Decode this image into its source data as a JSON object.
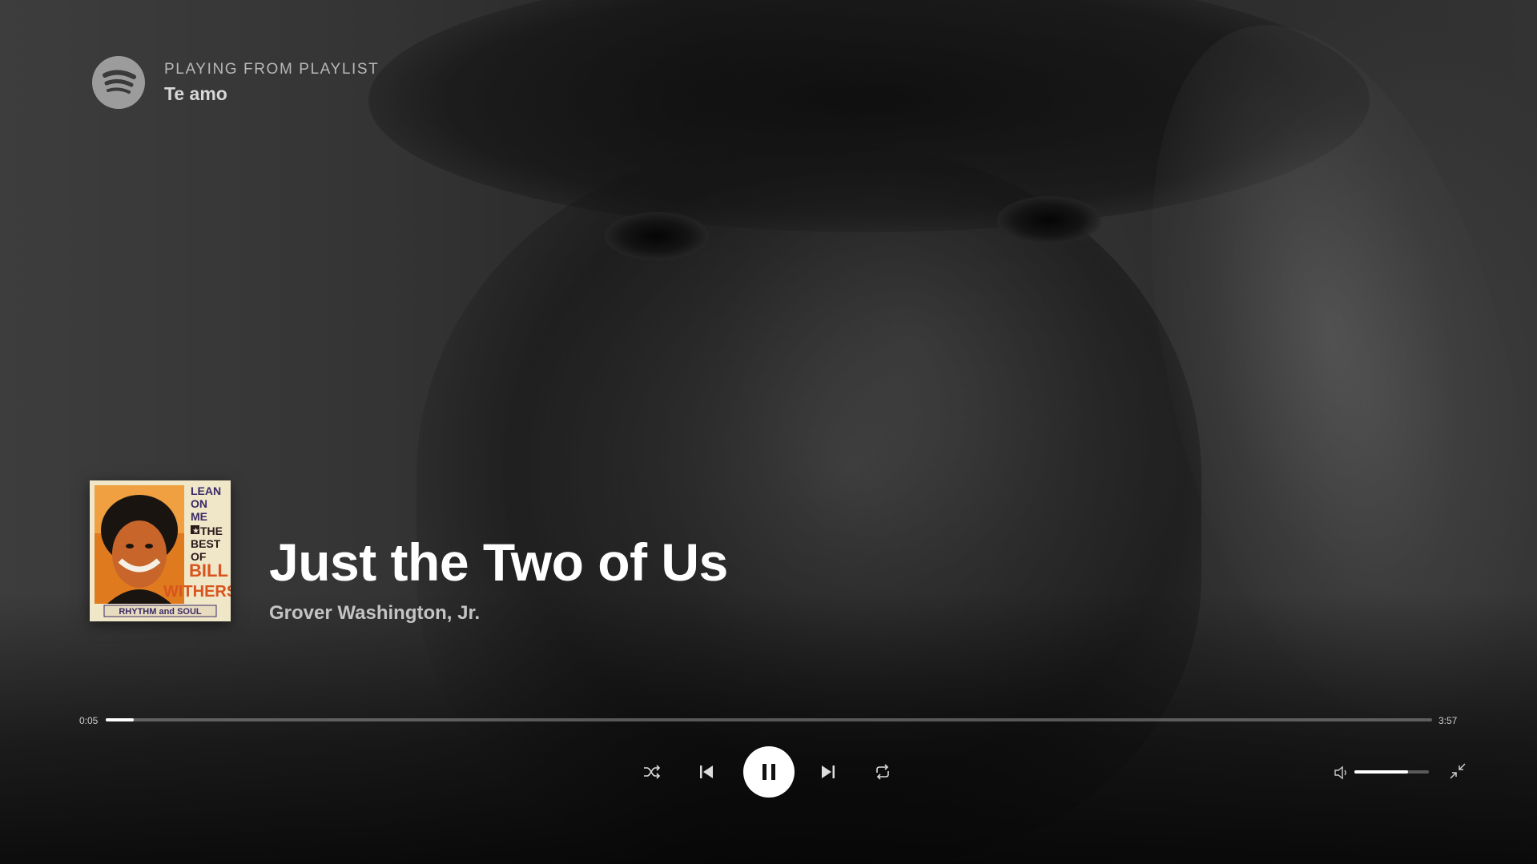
{
  "context": {
    "label": "PLAYING FROM PLAYLIST",
    "name": "Te amo"
  },
  "track": {
    "title": "Just the Two of Us",
    "artist": "Grover Washington, Jr.",
    "cover_text": {
      "line1": "LEAN",
      "line2": "ON",
      "line3": "ME",
      "line4": "THE",
      "line5": "BEST",
      "line6": "OF",
      "line7": "BILL",
      "line8": "WITHERS",
      "banner": "RHYTHM and SOUL"
    }
  },
  "progress": {
    "elapsed": "0:05",
    "total": "3:57",
    "fraction": 0.021
  },
  "volume": {
    "fraction": 0.72
  },
  "controls": {
    "shuffle_icon": "shuffle-icon",
    "previous_icon": "skip-back-icon",
    "play_state": "pause-icon",
    "next_icon": "skip-forward-icon",
    "repeat_icon": "repeat-icon",
    "volume_icon": "speaker-icon",
    "fullscreen_icon": "exit-fullscreen-icon"
  },
  "colors": {
    "accent": "#ffffff",
    "track_bg": "#4d4d4d",
    "logo": "#9c9c9c"
  }
}
